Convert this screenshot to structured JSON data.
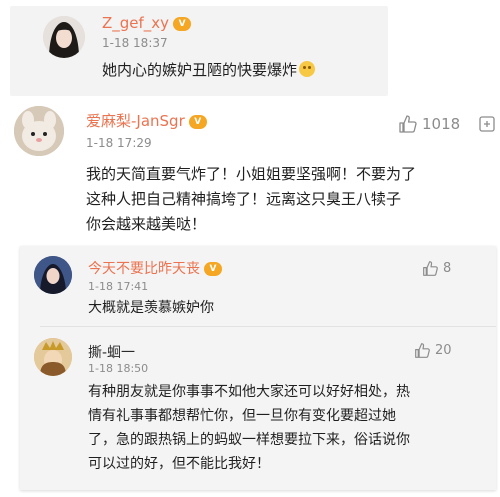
{
  "colors": {
    "username": "#eb7350",
    "meta": "#8c8c8c",
    "vip_badge": "#f5a623"
  },
  "top_comment": {
    "username": "Z_gef_xy",
    "time": "1-18 18:37",
    "text": "她内心的嫉妒丑陋的快要爆炸",
    "emoji": "smile-emoji"
  },
  "main_comment": {
    "username": "爱麻梨-JanSgr",
    "time": "1-18 17:29",
    "likes": "1018",
    "lines": [
      "我的天简直要气炸了！小姐姐要坚强啊！不要为了",
      "这种人把自己精神搞垮了！远离这只臭王八犊子",
      "你会越来越美哒！"
    ]
  },
  "replies": [
    {
      "username": "今天不要比昨天丧",
      "time": "1-18 17:41",
      "likes": "8",
      "lines": [
        "大概就是羡慕嫉妒你"
      ]
    },
    {
      "username": "撕-蛔一",
      "time": "1-18 18:50",
      "likes": "20",
      "lines": [
        "有种朋友就是你事事不如他大家还可以好好相处，热",
        "情有礼事事都想帮忙你，但一旦你有变化要超过她",
        "了，急的跟热锅上的蚂蚁一样想要拉下来，俗话说你",
        "可以过的好，但不能比我好！"
      ]
    }
  ]
}
